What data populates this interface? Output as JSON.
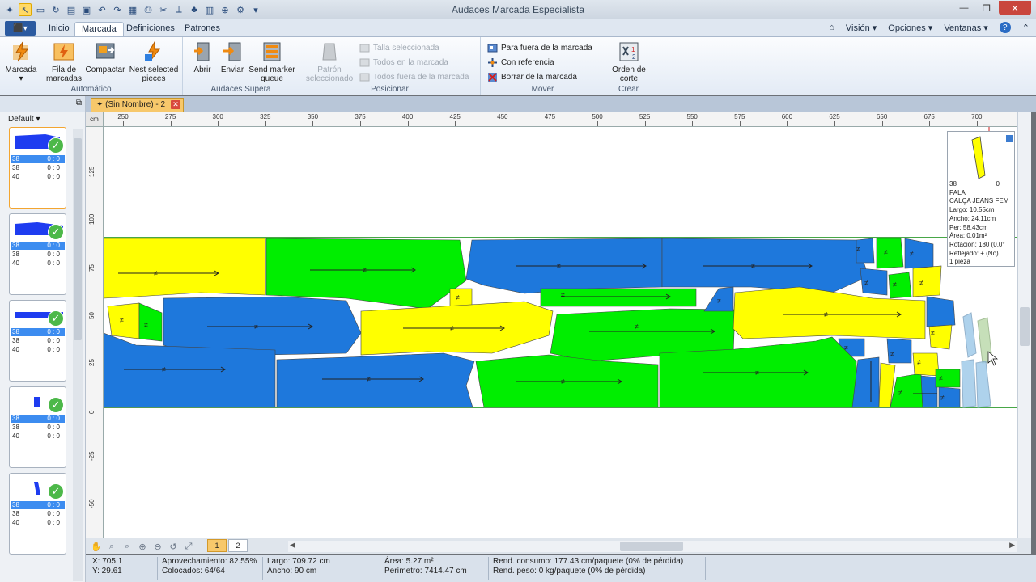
{
  "app": {
    "title": "Audaces Marcada Especialista",
    "file_button": "⬛▾"
  },
  "tabs": [
    "Inicio",
    "Marcada",
    "Definiciones",
    "Patrones"
  ],
  "right_menu": [
    "Visión",
    "Opciones",
    "Ventanas"
  ],
  "ribbon": {
    "automatico": {
      "label": "Automático",
      "buttons": [
        "Marcada",
        "Fila de marcadas",
        "Compactar",
        "Nest selected pieces"
      ]
    },
    "supera": {
      "label": "Audaces Supera",
      "buttons": [
        "Abrir",
        "Enviar",
        "Send marker queue"
      ]
    },
    "posicionar": {
      "label": "Posicionar",
      "big": "Patrón seleccionado",
      "small": [
        "Talla seleccionada",
        "Todos en la marcada",
        "Todos fuera de la marcada"
      ]
    },
    "mover": {
      "label": "Mover",
      "small": [
        "Para fuera de la marcada",
        "Con referencia",
        "Borrar de la marcada"
      ]
    },
    "crear": {
      "label": "Crear",
      "big": "Orden de corte"
    }
  },
  "left_panel": {
    "filter": "Default",
    "pieces": [
      {
        "rows": [
          [
            "38",
            "0",
            "0"
          ],
          [
            "38",
            "0",
            "0"
          ],
          [
            "40",
            "0",
            "0"
          ]
        ],
        "icon": "waistband-piece"
      },
      {
        "rows": [
          [
            "38",
            "0",
            "0"
          ],
          [
            "38",
            "0",
            "0"
          ],
          [
            "40",
            "0",
            "0"
          ]
        ],
        "icon": "waistband-piece"
      },
      {
        "rows": [
          [
            "38",
            "0",
            "0"
          ],
          [
            "38",
            "0",
            "0"
          ],
          [
            "40",
            "0",
            "0"
          ]
        ],
        "icon": "strip-piece"
      },
      {
        "rows": [
          [
            "38",
            "0",
            "0"
          ],
          [
            "38",
            "0",
            "0"
          ],
          [
            "40",
            "0",
            "0"
          ]
        ],
        "icon": "small-piece"
      },
      {
        "rows": [
          [
            "38",
            "0",
            "0"
          ],
          [
            "38",
            "0",
            "0"
          ],
          [
            "40",
            "0",
            "0"
          ]
        ],
        "icon": "loop-piece"
      }
    ]
  },
  "document": {
    "tab_title": "(Sin Nombre) - 2",
    "unit": "cm",
    "ruler_top": [
      "250",
      "275",
      "300",
      "325",
      "350",
      "375",
      "400",
      "425",
      "450",
      "475",
      "500",
      "525",
      "550",
      "575",
      "600",
      "625",
      "650",
      "675",
      "700"
    ],
    "ruler_left": [
      "125",
      "100",
      "75",
      "50",
      "25",
      "0",
      "-25",
      "-50"
    ],
    "pages": [
      "1",
      "2"
    ]
  },
  "info_box": {
    "size": "38",
    "qty": "0",
    "lines": [
      "PALA",
      "CALÇA JEANS FEM",
      "Largo: 10.55cm",
      "Ancho: 24.11cm",
      "Per: 58.43cm",
      "Área: 0.01m²",
      "Rotación: 180  (0.0°",
      "Reflejado: +  (No)",
      "1 pieza"
    ]
  },
  "status": {
    "x": "X: 705.1",
    "y": "Y: 29.61",
    "aprov": "Aprovechamiento: 82.55%",
    "colocados": "Colocados: 64/64",
    "largo": "Largo: 709.72 cm",
    "ancho": "Ancho: 90 cm",
    "area": "Área: 5.27 m²",
    "perimetro": "Perímetro: 7414.47 cm",
    "consumo": "Rend. consumo: 177.43 cm/paquete (0% de pérdida)",
    "peso": "Rend. peso: 0 kg/paquete (0% de pérdida)"
  },
  "colors": {
    "yellow": "#ffff00",
    "green": "#00ee00",
    "blue": "#1e78dc",
    "accent": "#f7c86b"
  }
}
